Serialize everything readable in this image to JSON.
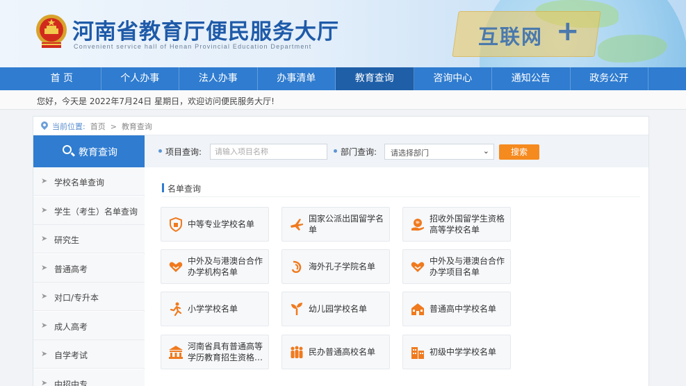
{
  "header": {
    "title": "河南省教育厅便民服务大厅",
    "subtitle": "Convenient service hall of Henan Provincial Education Department",
    "slogan": "互联网",
    "slogan_plus": "+"
  },
  "nav": {
    "items": [
      {
        "label": "首 页"
      },
      {
        "label": "个人办事"
      },
      {
        "label": "法人办事"
      },
      {
        "label": "办事清单"
      },
      {
        "label": "教育查询"
      },
      {
        "label": "咨询中心"
      },
      {
        "label": "通知公告"
      },
      {
        "label": "政务公开"
      }
    ],
    "active_index": 4
  },
  "welcome": "您好，今天是 2022年7月24日 星期日，欢迎访问便民服务大厅!",
  "breadcrumb": {
    "label": "当前位置:",
    "items": [
      "首页",
      "教育查询"
    ],
    "separator": ">"
  },
  "sidebar": {
    "title": "教育查询",
    "items": [
      {
        "label": "学校名单查询"
      },
      {
        "label": "学生（考生）名单查询"
      },
      {
        "label": "研究生"
      },
      {
        "label": "普通高考"
      },
      {
        "label": "对口/专升本"
      },
      {
        "label": "成人高考"
      },
      {
        "label": "自学考试"
      },
      {
        "label": "中招中专"
      }
    ]
  },
  "search": {
    "project_label": "项目查询:",
    "project_placeholder": "请输入项目名称",
    "dept_label": "部门查询:",
    "dept_selected": "请选择部门",
    "button": "搜索"
  },
  "section": {
    "title": "名单查询"
  },
  "cards": [
    {
      "label": "中等专业学校名单",
      "icon": "shield-icon"
    },
    {
      "label": "国家公派出国留学名单",
      "icon": "airplane-icon"
    },
    {
      "label": "招收外国留学生资格高等学校名单",
      "icon": "globe-hand-icon"
    },
    {
      "label": "中外及与港澳台合作办学机构名单",
      "icon": "heart-hands-icon"
    },
    {
      "label": "海外孔子学院名单",
      "icon": "confucius-icon"
    },
    {
      "label": "中外及与港澳台合作办学项目名单",
      "icon": "heart-hands-icon"
    },
    {
      "label": "小学学校名单",
      "icon": "running-child-icon"
    },
    {
      "label": "幼儿园学校名单",
      "icon": "sprout-icon"
    },
    {
      "label": "普通高中学校名单",
      "icon": "school-building-icon"
    },
    {
      "label": "河南省具有普通高等学历教育招生资格…",
      "icon": "university-icon"
    },
    {
      "label": "民办普通高校名单",
      "icon": "people-group-icon"
    },
    {
      "label": "初级中学学校名单",
      "icon": "buildings-icon"
    }
  ],
  "colors": {
    "primary": "#2f7cd0",
    "nav_active": "#1f5fa8",
    "accent_orange": "#f58a1f",
    "title_blue": "#1e5aa8"
  }
}
